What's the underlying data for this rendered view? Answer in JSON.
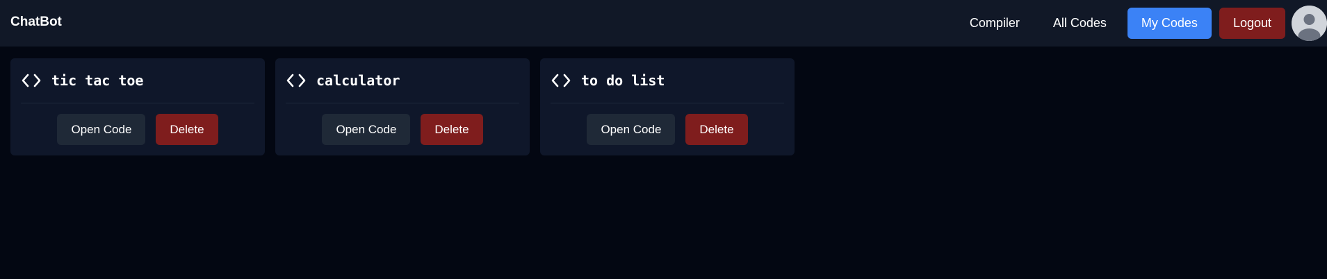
{
  "navbar": {
    "brand": "ChatBot",
    "links": [
      {
        "label": "Compiler"
      },
      {
        "label": "All Codes"
      }
    ],
    "my_codes_label": "My Codes",
    "logout_label": "Logout",
    "avatar_icon": "user-avatar-icon"
  },
  "cards": [
    {
      "title": "tic tac toe",
      "icon": "code-icon",
      "open_label": "Open Code",
      "delete_label": "Delete"
    },
    {
      "title": "calculator",
      "icon": "code-icon",
      "open_label": "Open Code",
      "delete_label": "Delete"
    },
    {
      "title": "to do list",
      "icon": "code-icon",
      "open_label": "Open Code",
      "delete_label": "Delete"
    }
  ],
  "colors": {
    "background": "#030712",
    "navbar": "#111827",
    "card": "#0f172a",
    "accent_blue": "#3b82f6",
    "danger_red": "#7f1d1d",
    "secondary_button": "#1f2937"
  }
}
